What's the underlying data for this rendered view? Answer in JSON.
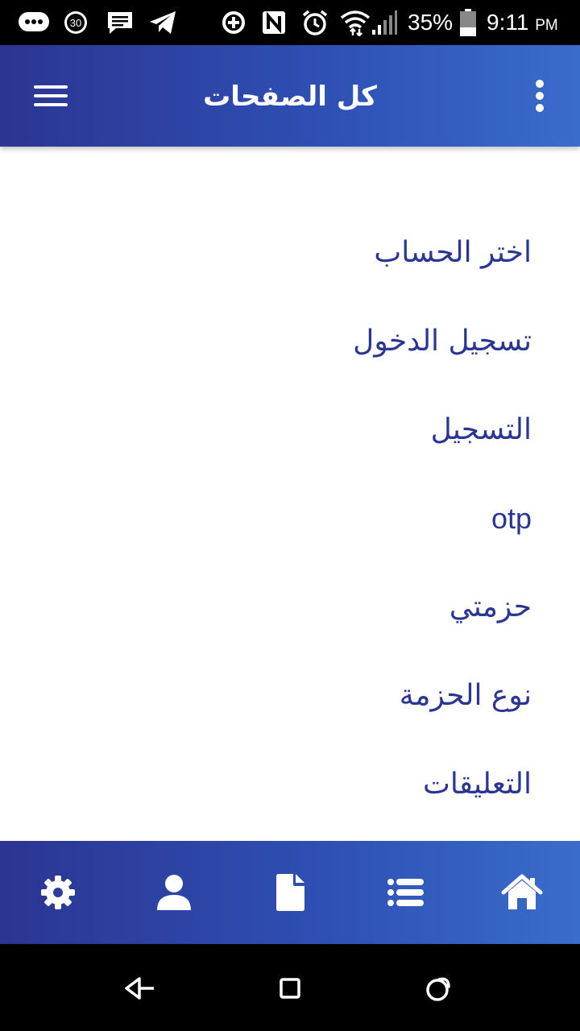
{
  "status_bar": {
    "notification_count": "30",
    "battery_percent": "35%",
    "time": "9:11",
    "am_pm": "PM",
    "icons": [
      "chat-bubble-icon",
      "notification-count-icon",
      "message-icon",
      "telegram-icon",
      "data-saver-icon",
      "nfc-icon",
      "alarm-icon",
      "wifi-icon",
      "signal-icon",
      "battery-icon"
    ]
  },
  "app_bar": {
    "title": "كل الصفحات",
    "menu_icon": "hamburger-menu-icon",
    "more_icon": "more-vert-icon"
  },
  "pages": {
    "items": [
      "اختر الحساب",
      "تسجيل الدخول",
      "التسجيل",
      "otp",
      "حزمتي",
      "نوع الحزمة",
      "التعليقات"
    ]
  },
  "bottom_nav": {
    "items": [
      "gear-icon",
      "user-icon",
      "document-icon",
      "list-icon",
      "home-icon"
    ]
  },
  "system_nav": {
    "items": [
      "back-icon",
      "home-square-icon",
      "recents-icon"
    ]
  },
  "colors": {
    "primary_dark": "#2c3591",
    "primary_light": "#3a6ccc",
    "list_text": "#2b3592"
  }
}
